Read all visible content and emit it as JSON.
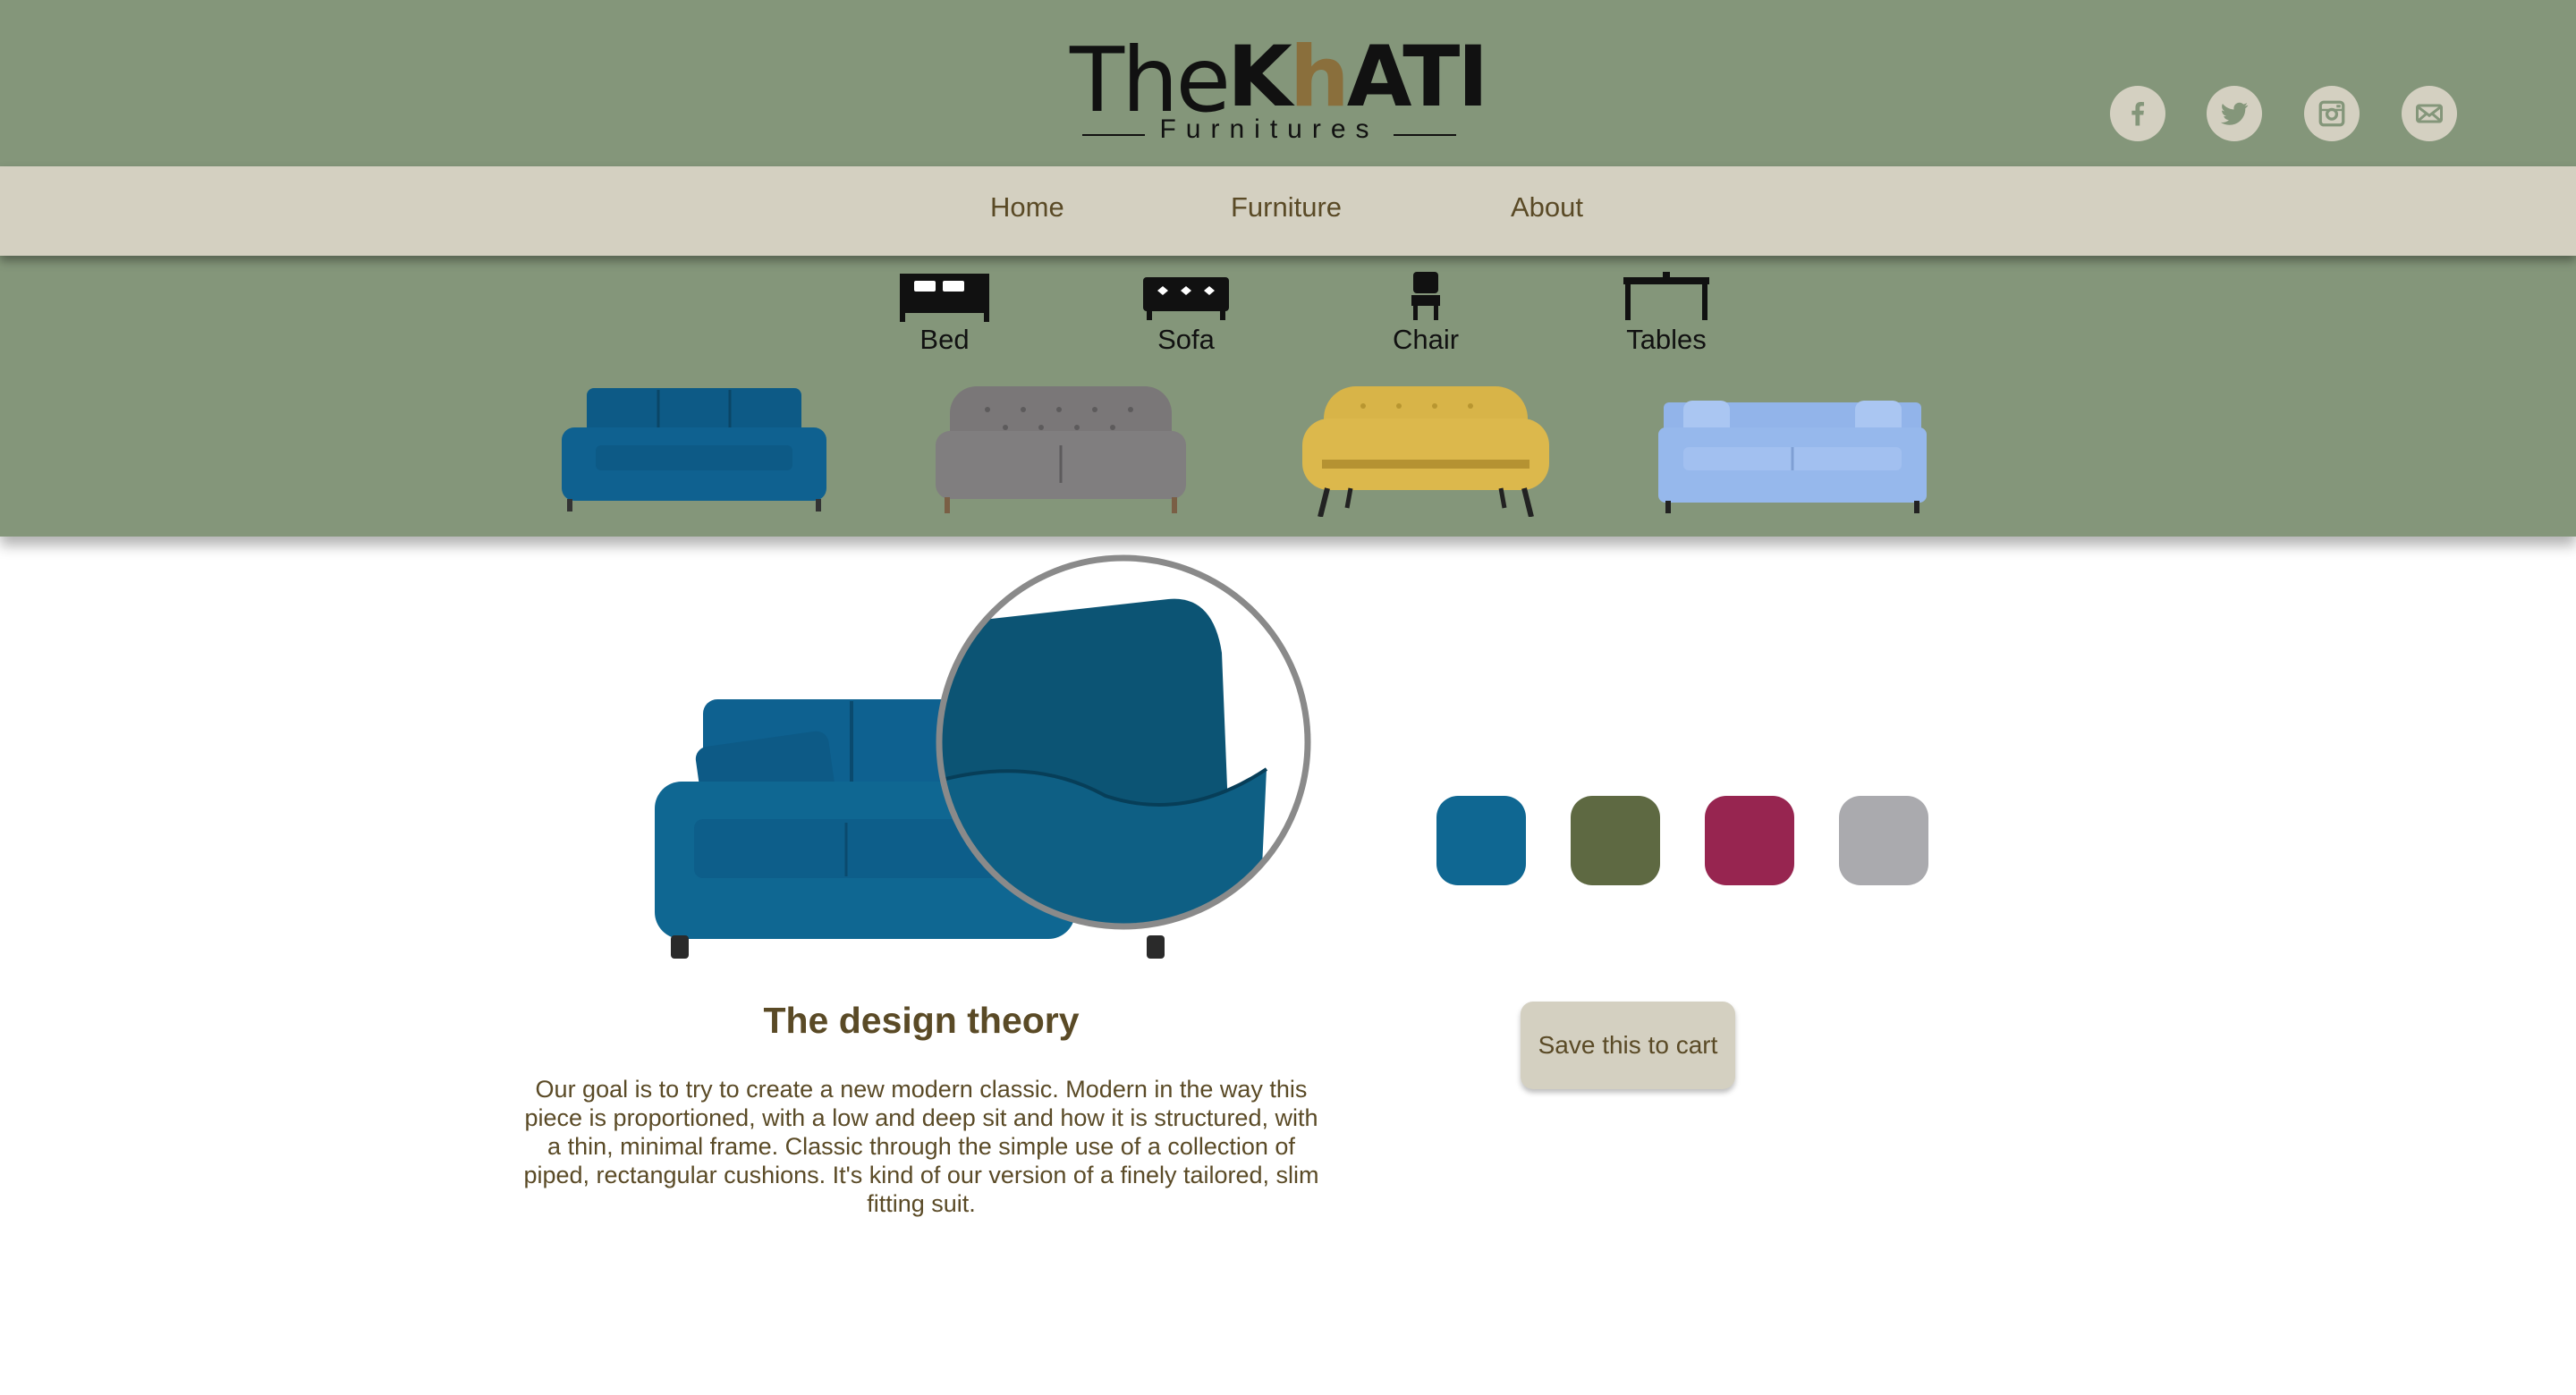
{
  "brand": {
    "the": "The",
    "khati_k": "K",
    "khati_h": "h",
    "khati_rest": "ATI",
    "tagline": "Furnitures"
  },
  "social": [
    "facebook-icon",
    "twitter-icon",
    "instagram-icon",
    "mail-icon"
  ],
  "nav": {
    "items": [
      "Home",
      "Furniture",
      "About"
    ]
  },
  "categories": [
    {
      "label": "Bed",
      "icon": "bed-icon"
    },
    {
      "label": "Sofa",
      "icon": "sofa-icon"
    },
    {
      "label": "Chair",
      "icon": "chair-icon"
    },
    {
      "label": "Tables",
      "icon": "table-icon"
    }
  ],
  "thumbnails": [
    {
      "color": "#0d5a86"
    },
    {
      "color": "#7a7778"
    },
    {
      "color": "#d8b448"
    },
    {
      "color": "#92b4ea"
    }
  ],
  "product": {
    "title": "The design theory",
    "description": "Our goal is to try to create a new modern classic. Modern in the way this piece is proportioned, with a low and deep sit and how it is structured, with a thin, minimal frame. Classic through the simple use of a collection of piped, rectangular cushions. It's kind of our version of a finely tailored, slim fitting suit.",
    "colors": [
      "#0f6792",
      "#5e6942",
      "#972550",
      "#aaaaae"
    ],
    "cart_label": "Save this to cart"
  }
}
